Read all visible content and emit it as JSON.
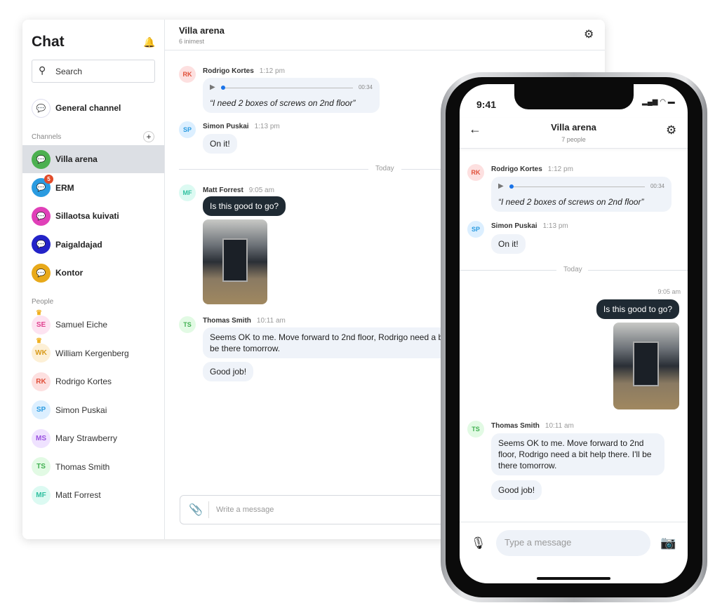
{
  "desktop": {
    "sidebar": {
      "title": "Chat",
      "search_placeholder": "Search",
      "general": "General channel",
      "channels_label": "Channels",
      "people_label": "People",
      "channels": [
        {
          "label": "Villa arena",
          "color": "#4cb050",
          "selected": true
        },
        {
          "label": "ERM",
          "color": "#2a9be0",
          "badge": "5"
        },
        {
          "label": "Sillaotsa kuivati",
          "color": "#e040b8"
        },
        {
          "label": "Paigaldajad",
          "color": "#2323c8"
        },
        {
          "label": "Kontor",
          "color": "#e8a91a"
        }
      ],
      "people": [
        {
          "initials": "SE",
          "name": "Samuel Eiche",
          "bg": "#fde3f1",
          "fg": "#e0408f",
          "crown": true
        },
        {
          "initials": "WK",
          "name": "William Kergenberg",
          "bg": "#fdf0d6",
          "fg": "#d89a1a",
          "crown": true
        },
        {
          "initials": "RK",
          "name": "Rodrigo Kortes",
          "bg": "#fde0e0",
          "fg": "#e0503a"
        },
        {
          "initials": "SP",
          "name": "Simon Puskai",
          "bg": "#dcefff",
          "fg": "#2a9be0"
        },
        {
          "initials": "MS",
          "name": "Mary Strawberry",
          "bg": "#efe2ff",
          "fg": "#9a50e0"
        },
        {
          "initials": "TS",
          "name": "Thomas Smith",
          "bg": "#e2fae4",
          "fg": "#40b050"
        },
        {
          "initials": "MF",
          "name": "Matt Forrest",
          "bg": "#dcfaf2",
          "fg": "#30c0a0"
        }
      ]
    },
    "header": {
      "title": "Villa arena",
      "subtitle": "6 inimest"
    },
    "messages": {
      "rk": {
        "initials": "RK",
        "name": "Rodrigo Kortes",
        "time": "1:12 pm",
        "duration": "00:34",
        "text": "“I need 2 boxes of screws on 2nd floor”"
      },
      "sp": {
        "initials": "SP",
        "name": "Simon Puskai",
        "time": "1:13 pm",
        "text": "On it!"
      },
      "divider": "Today",
      "mf": {
        "initials": "MF",
        "name": "Matt Forrest",
        "time": "9:05 am",
        "text": "Is this good to go?"
      },
      "ts": {
        "initials": "TS",
        "name": "Thomas Smith",
        "time": "10:11 am",
        "text": "Seems OK to me. Move forward to 2nd floor, Rodrigo need a bit help there. I'll be there tomorrow.",
        "text2": "Good job!"
      }
    },
    "composer_placeholder": "Write a message"
  },
  "phone": {
    "time": "9:41",
    "title": "Villa arena",
    "subtitle": "7 people",
    "rk": {
      "initials": "RK",
      "name": "Rodrigo Kortes",
      "time": "1:12 pm",
      "duration": "00:34",
      "text": "“I need 2 boxes of screws on 2nd floor”"
    },
    "sp": {
      "initials": "SP",
      "name": "Simon Puskai",
      "time": "1:13 pm",
      "text": "On it!"
    },
    "divider": "Today",
    "own": {
      "time": "9:05 am",
      "text": "Is this good to go?"
    },
    "ts": {
      "initials": "TS",
      "name": "Thomas Smith",
      "time": "10:11 am",
      "text": "Seems OK to me. Move forward to 2nd floor, Rodrigo need a bit help there. I'll be there tomorrow.",
      "text2": "Good job!"
    },
    "composer_placeholder": "Type a message"
  }
}
